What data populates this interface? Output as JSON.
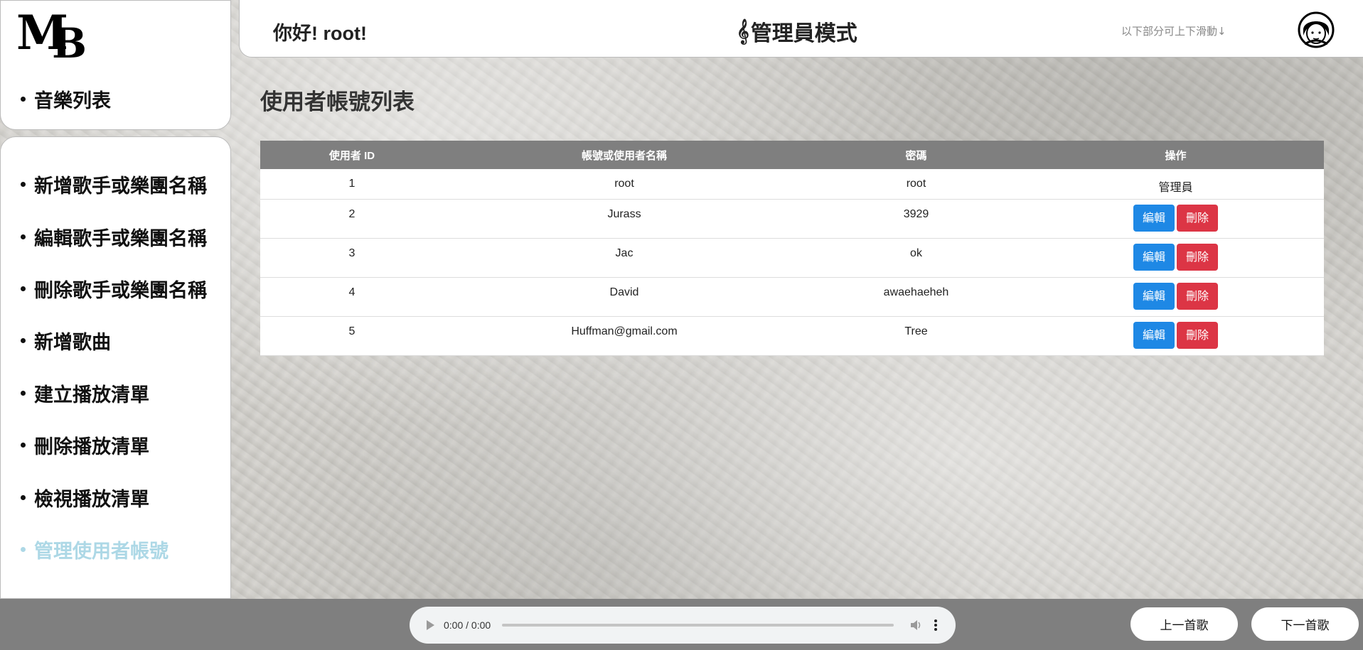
{
  "sidebar": {
    "top_item": "音樂列表",
    "items": [
      {
        "label": "新增歌手或樂團名稱"
      },
      {
        "label": "編輯歌手或樂團名稱"
      },
      {
        "label": "刪除歌手或樂團名稱"
      },
      {
        "label": "新增歌曲"
      },
      {
        "label": "建立播放清單"
      },
      {
        "label": "刪除播放清單"
      },
      {
        "label": "檢視播放清單"
      },
      {
        "label": "管理使用者帳號"
      }
    ],
    "active_color": "#add8e6"
  },
  "header": {
    "greeting": "你好! root!",
    "mode_icon": "𝄞",
    "mode_title": "管理員模式",
    "scroll_hint": "以下部分可上下滑動↓"
  },
  "main": {
    "title": "使用者帳號列表",
    "columns": [
      "使用者 ID",
      "帳號或使用者名稱",
      "密碼",
      "操作"
    ],
    "rows": [
      {
        "id": "1",
        "name": "root",
        "password": "root",
        "action": "管理員"
      },
      {
        "id": "2",
        "name": "Jurass",
        "password": "3929"
      },
      {
        "id": "3",
        "name": "Jac",
        "password": "ok"
      },
      {
        "id": "4",
        "name": "David",
        "password": "awaehaeheh"
      },
      {
        "id": "5",
        "name": "Huffman@gmail.com",
        "password": "Tree"
      }
    ],
    "edit_label": "編輯",
    "delete_label": "刪除",
    "colors": {
      "edit": "#1e88e5",
      "delete": "#dc3545",
      "header": "#7f7f7f"
    }
  },
  "footer": {
    "time": "0:00 / 0:00",
    "prev_label": "上一首歌",
    "next_label": "下一首歌",
    "icons": [
      "play-icon",
      "volume-icon",
      "more-vertical-icon"
    ]
  }
}
